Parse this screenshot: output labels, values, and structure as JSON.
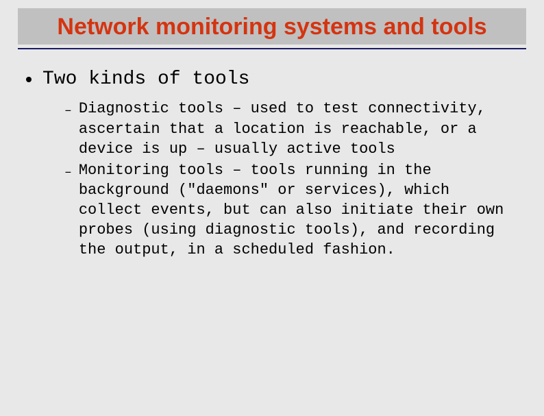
{
  "title": "Network monitoring systems and tools",
  "main_bullet": "Two kinds of tools",
  "sub_bullets": [
    "Diagnostic tools – used to test connectivity, ascertain that a location is reachable, or a device is up – usually active tools",
    "Monitoring tools – tools running in the background (\"daemons\" or services), which collect events, but can also initiate their own probes (using diagnostic tools), and recording the output, in a scheduled fashion."
  ]
}
